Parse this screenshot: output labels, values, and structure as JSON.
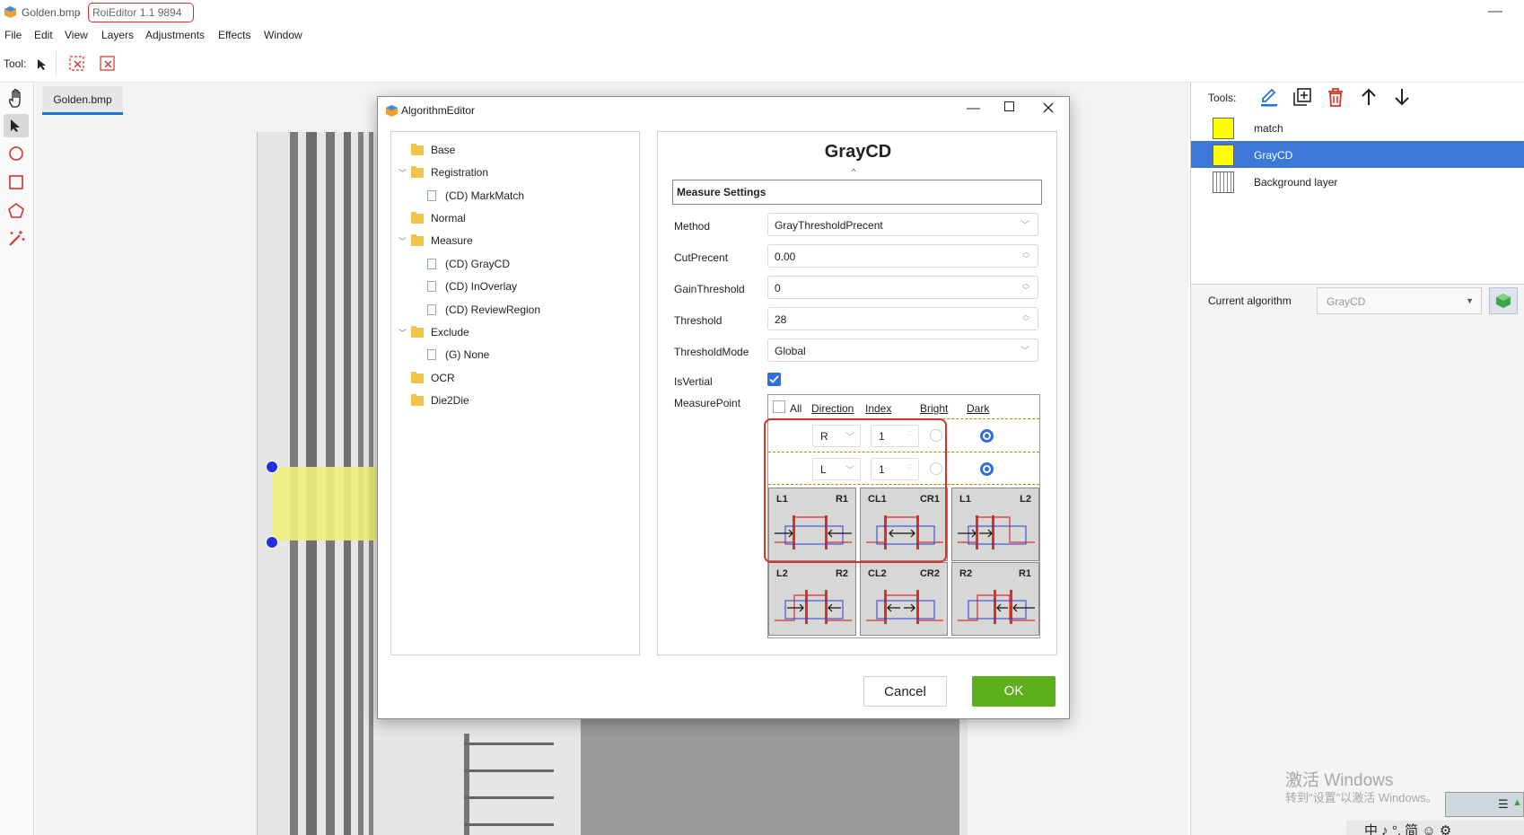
{
  "window": {
    "file_name": "Golden.bmp",
    "title_sep": " - ",
    "version": "RoiEditor 1.1 9894",
    "minimize": "—"
  },
  "menu": [
    "File",
    "Edit",
    "View",
    "Layers",
    "Adjustments",
    "Effects",
    "Window"
  ],
  "toolbar": {
    "label": "Tool:"
  },
  "canvas": {
    "tab": "Golden.bmp"
  },
  "right": {
    "tools_label": "Tools:",
    "layers": [
      {
        "name": "match",
        "color": "#ffff00"
      },
      {
        "name": "GrayCD",
        "color": "#ffff00"
      },
      {
        "name": "Background layer",
        "color": "#ffffff"
      }
    ],
    "current_label": "Current algorithm",
    "current_value": "GrayCD"
  },
  "dialog": {
    "title": "AlgorithmEditor",
    "tree": [
      {
        "label": "Base"
      },
      {
        "label": "Registration"
      },
      {
        "label": "(CD) MarkMatch"
      },
      {
        "label": "Normal"
      },
      {
        "label": "Measure"
      },
      {
        "label": "(CD) GrayCD"
      },
      {
        "label": "(CD) InOverlay"
      },
      {
        "label": "(CD) ReviewRegion"
      },
      {
        "label": "Exclude"
      },
      {
        "label": "(G) None"
      },
      {
        "label": "OCR"
      },
      {
        "label": "Die2Die"
      }
    ],
    "algo_name": "GrayCD",
    "section": "Measure Settings",
    "props": [
      {
        "label": "Method",
        "value": "GrayThresholdPrecent"
      },
      {
        "label": "CutPrecent",
        "value": "0.00"
      },
      {
        "label": "GainThreshold",
        "value": "0"
      },
      {
        "label": "Threshold",
        "value": "28"
      },
      {
        "label": "ThresholdMode",
        "value": "Global"
      },
      {
        "label": "IsVertial",
        "value": ""
      },
      {
        "label": "MeasurePoint",
        "value": ""
      }
    ],
    "is_vertial": true,
    "mp_header": {
      "all": "All",
      "direction": "Direction",
      "index": "Index",
      "bright": "Bright",
      "dark": "Dark"
    },
    "mp_rows": [
      {
        "direction": "R",
        "index": "1",
        "selected": "Dark"
      },
      {
        "direction": "L",
        "index": "1",
        "selected": "Dark"
      }
    ],
    "presets": [
      {
        "l": "L1",
        "r": "R1"
      },
      {
        "l": "CL1",
        "r": "CR1"
      },
      {
        "l": "L1",
        "r": "L2"
      },
      {
        "l": "L2",
        "r": "R2"
      },
      {
        "l": "CL2",
        "r": "CR2"
      },
      {
        "l": "R2",
        "r": "R1"
      }
    ],
    "cancel": "Cancel",
    "ok": "OK"
  },
  "watermark": {
    "line1": "激活 Windows",
    "line2": "转到\"设置\"以激活 Windows。"
  },
  "taskbar": "中 ♪ °, 简 ☺ ⚙",
  "colors": {
    "accent": "#1e73d6",
    "ok": "#5cae1a",
    "highlight": "#d9302a"
  }
}
